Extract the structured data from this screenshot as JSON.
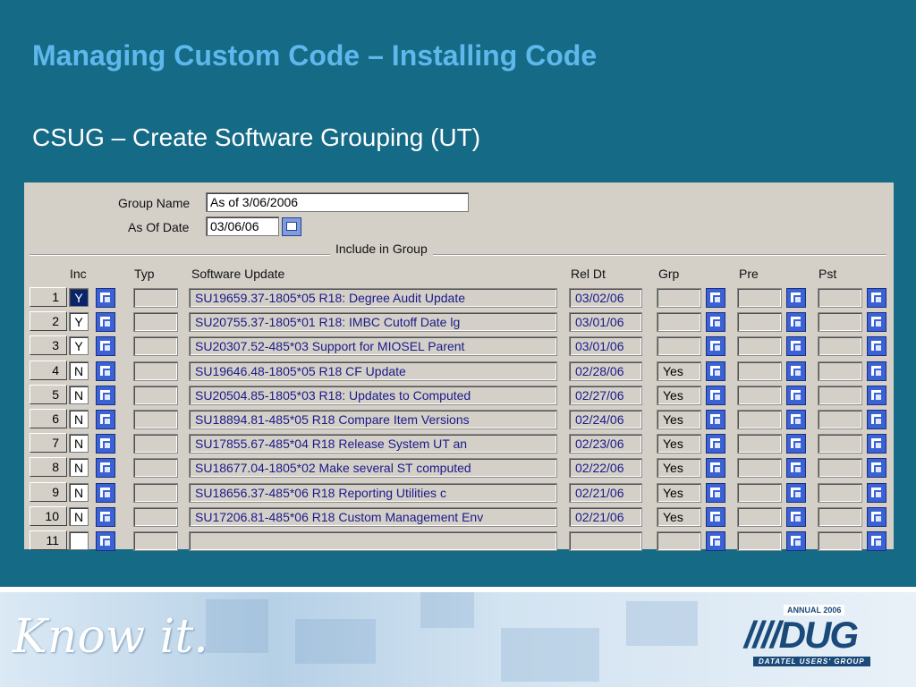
{
  "slide": {
    "title": "Managing Custom Code – Installing Code",
    "subtitle": "CSUG – Create Software Grouping (UT)"
  },
  "form": {
    "group_name_label": "Group Name",
    "group_name_value": "As of 3/06/2006",
    "as_of_date_label": "As Of Date",
    "as_of_date_value": "03/06/06",
    "include_group_label": "Include in Group"
  },
  "columns": {
    "inc": "Inc",
    "typ": "Typ",
    "software_update": "Software Update",
    "rel_dt": "Rel Dt",
    "grp": "Grp",
    "pre": "Pre",
    "pst": "Pst"
  },
  "rows": [
    {
      "num": "1",
      "inc": "Y",
      "update": "SU19659.37-1805*05 R18: Degree Audit Update",
      "rel_dt": "03/02/06",
      "grp": ""
    },
    {
      "num": "2",
      "inc": "Y",
      "update": "SU20755.37-1805*01 R18: IMBC Cutoff Date lg",
      "rel_dt": "03/01/06",
      "grp": ""
    },
    {
      "num": "3",
      "inc": "Y",
      "update": "SU20307.52-485*03 Support for MIOSEL Parent",
      "rel_dt": "03/01/06",
      "grp": ""
    },
    {
      "num": "4",
      "inc": "N",
      "update": "SU19646.48-1805*05 R18 CF Update",
      "rel_dt": "02/28/06",
      "grp": "Yes"
    },
    {
      "num": "5",
      "inc": "N",
      "update": "SU20504.85-1805*03 R18: Updates to Computed",
      "rel_dt": "02/27/06",
      "grp": "Yes"
    },
    {
      "num": "6",
      "inc": "N",
      "update": "SU18894.81-485*05 R18 Compare Item Versions",
      "rel_dt": "02/24/06",
      "grp": "Yes"
    },
    {
      "num": "7",
      "inc": "N",
      "update": "SU17855.67-485*04 R18 Release System  UT an",
      "rel_dt": "02/23/06",
      "grp": "Yes"
    },
    {
      "num": "8",
      "inc": "N",
      "update": "SU18677.04-1805*02 Make several ST computed",
      "rel_dt": "02/22/06",
      "grp": "Yes"
    },
    {
      "num": "9",
      "inc": "N",
      "update": "SU18656.37-485*06 R18 Reporting Utilities c",
      "rel_dt": "02/21/06",
      "grp": "Yes"
    },
    {
      "num": "10",
      "inc": "N",
      "update": "SU17206.81-485*06 R18 Custom Management Env",
      "rel_dt": "02/21/06",
      "grp": "Yes"
    },
    {
      "num": "11",
      "inc": "",
      "update": "",
      "rel_dt": "",
      "grp": ""
    }
  ],
  "footer": {
    "tagline": "Know it.",
    "logo_top": "ANNUAL 2006",
    "logo_main": "////DUG",
    "logo_sub": "DATATEL USERS' GROUP"
  },
  "colors": {
    "background": "#156a86",
    "title": "#5fb8ec",
    "window": "#d4d0c8",
    "lookup_button": "#3b62d4"
  }
}
